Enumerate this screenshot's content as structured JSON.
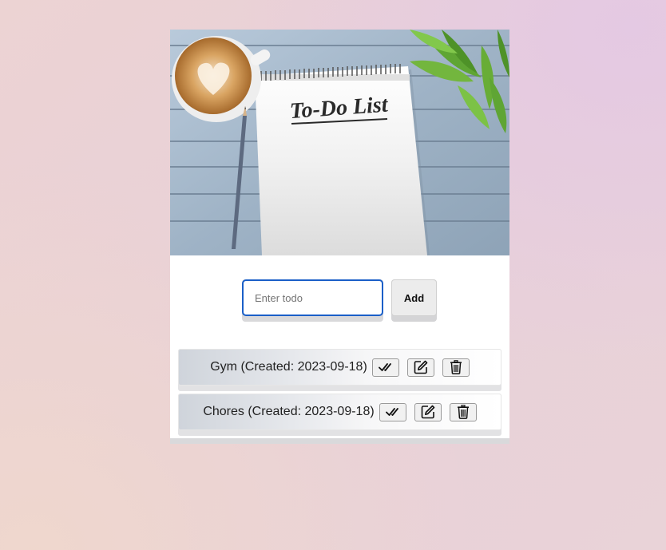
{
  "hero": {
    "title": "To-Do List"
  },
  "form": {
    "input_placeholder": "Enter todo",
    "input_value": "",
    "add_label": "Add"
  },
  "todos": [
    {
      "text": "Gym (Created: 2023-09-18)",
      "complete_icon": "double-check-icon",
      "edit_icon": "edit-square-icon",
      "delete_icon": "trash-icon"
    },
    {
      "text": "Chores (Created: 2023-09-18)",
      "complete_icon": "double-check-icon",
      "edit_icon": "edit-square-icon",
      "delete_icon": "trash-icon"
    }
  ],
  "colors": {
    "input_focus_border": "#1a5fc8",
    "background_start": "#ecd3d3",
    "background_end": "#e9d3d8"
  }
}
